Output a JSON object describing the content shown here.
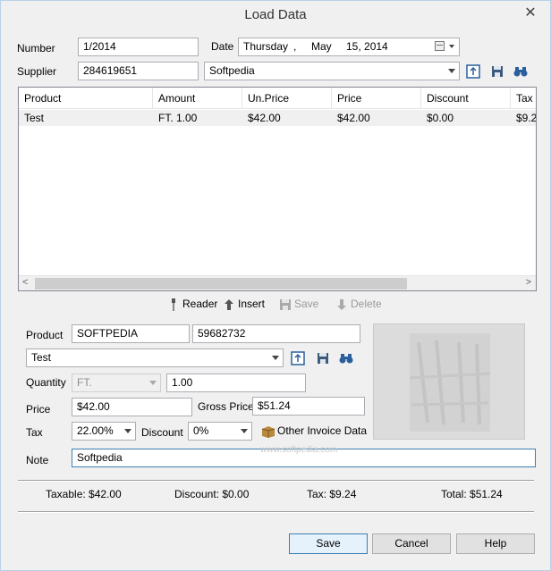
{
  "window": {
    "title": "Load Data",
    "close_glyph": "✕"
  },
  "header": {
    "number_label": "Number",
    "number_value": "1/2014",
    "date_label": "Date",
    "date_weekday": "Thursday",
    "date_sep": ",",
    "date_month": "May",
    "date_day_year": "15, 2014",
    "supplier_label": "Supplier",
    "supplier_code": "284619651",
    "supplier_name": "Softpedia"
  },
  "grid": {
    "columns": [
      "Product",
      "Amount",
      "Un.Price",
      "Price",
      "Discount",
      "Tax"
    ],
    "rows": [
      [
        "Test",
        "FT. 1.00",
        "$42.00",
        "$42.00",
        "$0.00",
        "$9.2"
      ]
    ],
    "scroll_left": "<",
    "scroll_right": ">"
  },
  "toolbar": {
    "reader_label": "Reader",
    "insert_label": "Insert",
    "save_label": "Save",
    "delete_label": "Delete"
  },
  "item": {
    "product_label": "Product",
    "product_name": "SOFTPEDIA",
    "product_code": "59682732",
    "product_select": "Test",
    "quantity_label": "Quantity",
    "unit_value": "FT.",
    "quantity_value": "1.00",
    "price_label": "Price",
    "price_value": "$42.00",
    "gross_label": "Gross Price",
    "gross_value": "$51.24",
    "tax_label": "Tax",
    "tax_value": "22.00%",
    "discount_label": "Discount",
    "discount_value": "0%",
    "other_invoice_label": "Other Invoice Data",
    "note_label": "Note",
    "note_value": "Softpedia"
  },
  "totals": {
    "taxable": "Taxable: $42.00",
    "discount": "Discount: $0.00",
    "tax": "Tax: $9.24",
    "total": "Total: $51.24"
  },
  "footer": {
    "save_label": "Save",
    "cancel_label": "Cancel",
    "help_label": "Help"
  },
  "watermark": "www.softpedia.com",
  "icons": {
    "open": "open-icon",
    "save": "floppy-icon",
    "find": "binoculars-icon",
    "reader": "scanner-icon",
    "insert": "arrow-up-icon",
    "delete": "arrow-down-icon",
    "other_invoice": "box-icon"
  },
  "colors": {
    "accent": "#3c7fb1",
    "icon_blue": "#2b5f9e"
  }
}
